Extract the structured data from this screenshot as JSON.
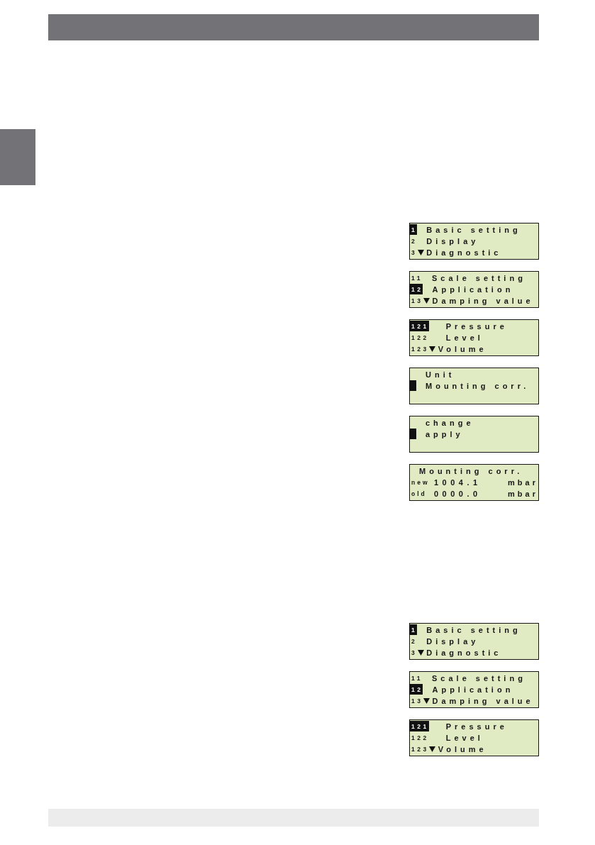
{
  "groups": [
    {
      "displays": [
        {
          "kind": "menu",
          "lines": [
            {
              "index": "1",
              "selected": true,
              "scroll_down": false,
              "label": "Basic setting"
            },
            {
              "index": "2",
              "selected": false,
              "scroll_down": false,
              "label": "Display"
            },
            {
              "index": "3",
              "selected": false,
              "scroll_down": true,
              "label": "Diagnostic"
            }
          ]
        },
        {
          "kind": "menu",
          "lines": [
            {
              "index": "11",
              "selected": false,
              "scroll_down": false,
              "label": "Scale setting"
            },
            {
              "index": "12",
              "selected": true,
              "scroll_down": false,
              "label": "Application"
            },
            {
              "index": "13",
              "selected": false,
              "scroll_down": true,
              "label": "Damping value"
            }
          ]
        },
        {
          "kind": "menu",
          "lines": [
            {
              "index": "121",
              "selected": true,
              "scroll_down": false,
              "label": "Pressure"
            },
            {
              "index": "122",
              "selected": false,
              "scroll_down": false,
              "label": "Level"
            },
            {
              "index": "123",
              "selected": false,
              "scroll_down": true,
              "label": "Volume"
            }
          ]
        },
        {
          "kind": "menu",
          "lines": [
            {
              "selected": false,
              "scroll_down": false,
              "label": "Unit"
            },
            {
              "selected": true,
              "scroll_down": false,
              "label": "Mounting corr."
            }
          ]
        },
        {
          "kind": "menu",
          "lines": [
            {
              "selected": false,
              "scroll_down": false,
              "label": "change"
            },
            {
              "selected": true,
              "scroll_down": false,
              "label": "apply"
            }
          ]
        },
        {
          "kind": "readout",
          "title": "Mounting corr.",
          "rows": [
            {
              "label": "new",
              "value": "1004.1",
              "unit": "mbar"
            },
            {
              "label": "old",
              "value": "0000.0",
              "unit": "mbar"
            }
          ]
        }
      ]
    },
    {
      "displays": [
        {
          "kind": "menu",
          "lines": [
            {
              "index": "1",
              "selected": true,
              "scroll_down": false,
              "label": "Basic setting"
            },
            {
              "index": "2",
              "selected": false,
              "scroll_down": false,
              "label": "Display"
            },
            {
              "index": "3",
              "selected": false,
              "scroll_down": true,
              "label": "Diagnostic"
            }
          ]
        },
        {
          "kind": "menu",
          "lines": [
            {
              "index": "11",
              "selected": false,
              "scroll_down": false,
              "label": "Scale setting"
            },
            {
              "index": "12",
              "selected": true,
              "scroll_down": false,
              "label": "Application"
            },
            {
              "index": "13",
              "selected": false,
              "scroll_down": true,
              "label": "Damping value"
            }
          ]
        },
        {
          "kind": "menu",
          "lines": [
            {
              "index": "121",
              "selected": true,
              "scroll_down": false,
              "label": "Pressure"
            },
            {
              "index": "122",
              "selected": false,
              "scroll_down": false,
              "label": "Level"
            },
            {
              "index": "123",
              "selected": false,
              "scroll_down": true,
              "label": "Volume"
            }
          ]
        }
      ]
    }
  ]
}
